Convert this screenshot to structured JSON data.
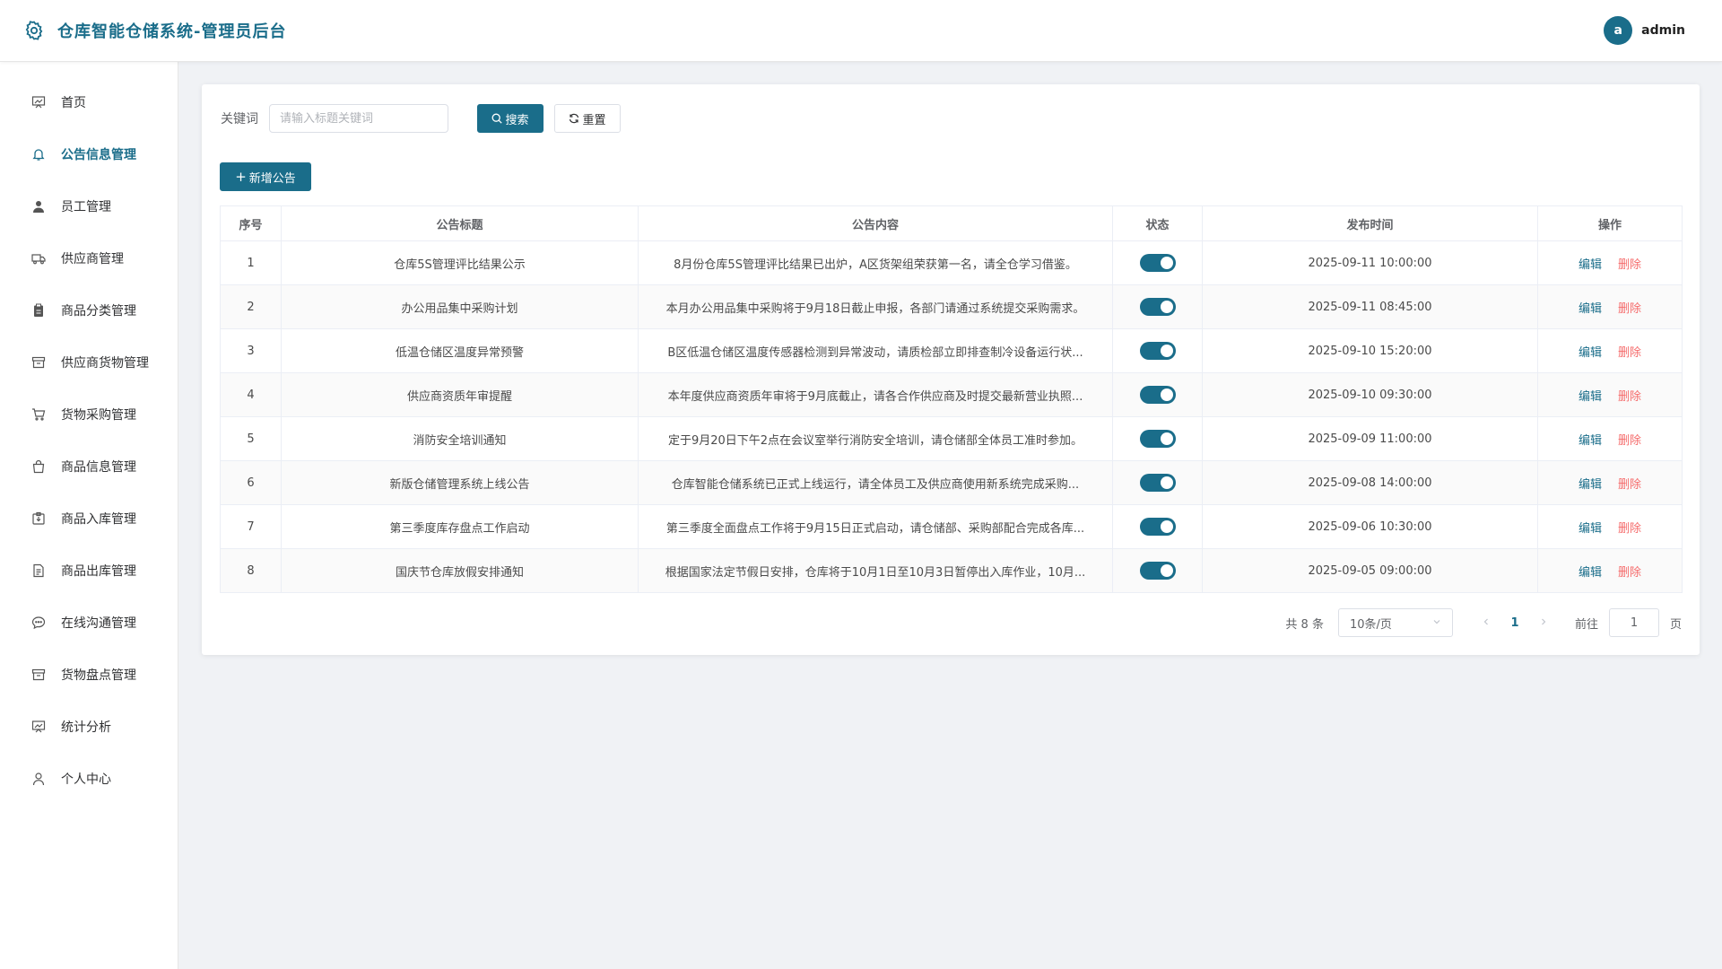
{
  "header": {
    "title": "仓库智能仓储系统-管理员后台",
    "avatar_letter": "a",
    "username": "admin",
    "accent": "#1a6d8a"
  },
  "sidebar": {
    "items": [
      {
        "label": "首页",
        "icon": "dashboard-icon",
        "active": false
      },
      {
        "label": "公告信息管理",
        "icon": "bell-icon",
        "active": true
      },
      {
        "label": "员工管理",
        "icon": "user-icon",
        "active": false
      },
      {
        "label": "供应商管理",
        "icon": "truck-icon",
        "active": false
      },
      {
        "label": "商品分类管理",
        "icon": "clipboard-icon",
        "active": false
      },
      {
        "label": "供应商货物管理",
        "icon": "box-icon",
        "active": false
      },
      {
        "label": "货物采购管理",
        "icon": "cart-icon",
        "active": false
      },
      {
        "label": "商品信息管理",
        "icon": "bag-icon",
        "active": false
      },
      {
        "label": "商品入库管理",
        "icon": "inbox-icon",
        "active": false
      },
      {
        "label": "商品出库管理",
        "icon": "document-icon",
        "active": false
      },
      {
        "label": "在线沟通管理",
        "icon": "chat-icon",
        "active": false
      },
      {
        "label": "货物盘点管理",
        "icon": "archive-icon",
        "active": false
      },
      {
        "label": "统计分析",
        "icon": "chart-icon",
        "active": false
      },
      {
        "label": "个人中心",
        "icon": "person-icon",
        "active": false
      }
    ]
  },
  "search": {
    "label": "关键词",
    "placeholder": "请输入标题关键词",
    "value": "",
    "search_button": "搜索",
    "reset_button": "重置"
  },
  "toolbar": {
    "add_button": "新增公告"
  },
  "table": {
    "columns": [
      "序号",
      "公告标题",
      "公告内容",
      "状态",
      "发布时间",
      "操作"
    ],
    "edit_label": "编辑",
    "delete_label": "删除",
    "rows": [
      {
        "no": "1",
        "title": "仓库5S管理评比结果公示",
        "content": "8月份仓库5S管理评比结果已出炉，A区货架组荣获第一名，请全仓学习借鉴。",
        "enabled": true,
        "time": "2025-09-11 10:00:00"
      },
      {
        "no": "2",
        "title": "办公用品集中采购计划",
        "content": "本月办公用品集中采购将于9月18日截止申报，各部门请通过系统提交采购需求。",
        "enabled": true,
        "time": "2025-09-11 08:45:00"
      },
      {
        "no": "3",
        "title": "低温仓储区温度异常预警",
        "content": "B区低温仓储区温度传感器检测到异常波动，请质检部立即排查制冷设备运行状...",
        "enabled": true,
        "time": "2025-09-10 15:20:00"
      },
      {
        "no": "4",
        "title": "供应商资质年审提醒",
        "content": "本年度供应商资质年审将于9月底截止，请各合作供应商及时提交最新营业执照...",
        "enabled": true,
        "time": "2025-09-10 09:30:00"
      },
      {
        "no": "5",
        "title": "消防安全培训通知",
        "content": "定于9月20日下午2点在会议室举行消防安全培训，请仓储部全体员工准时参加。",
        "enabled": true,
        "time": "2025-09-09 11:00:00"
      },
      {
        "no": "6",
        "title": "新版仓储管理系统上线公告",
        "content": "仓库智能仓储系统已正式上线运行，请全体员工及供应商使用新系统完成采购...",
        "enabled": true,
        "time": "2025-09-08 14:00:00"
      },
      {
        "no": "7",
        "title": "第三季度库存盘点工作启动",
        "content": "第三季度全面盘点工作将于9月15日正式启动，请仓储部、采购部配合完成各库...",
        "enabled": true,
        "time": "2025-09-06 10:30:00"
      },
      {
        "no": "8",
        "title": "国庆节仓库放假安排通知",
        "content": "根据国家法定节假日安排，仓库将于10月1日至10月3日暂停出入库作业，10月...",
        "enabled": true,
        "time": "2025-09-05 09:00:00"
      }
    ]
  },
  "pagination": {
    "total_text": "共 8 条",
    "page_size": "10条/页",
    "current_page": "1",
    "goto_label": "前往",
    "goto_value": "1",
    "page_suffix": "页"
  }
}
